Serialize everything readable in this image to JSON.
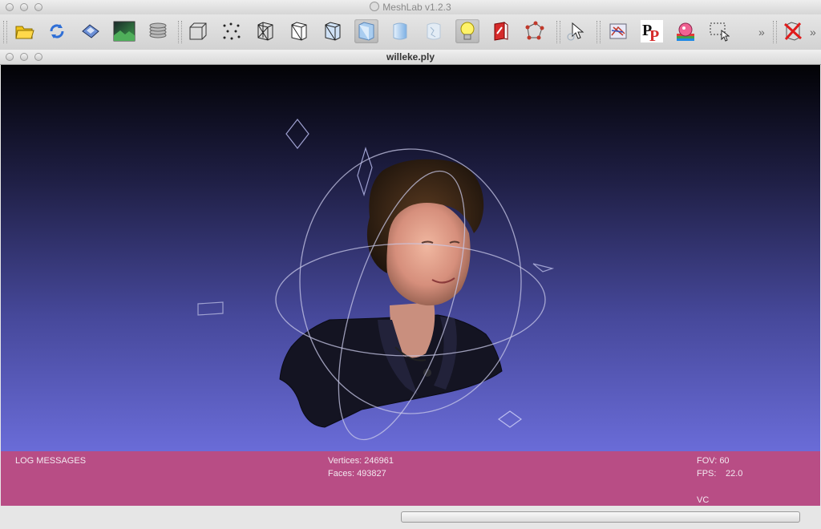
{
  "app": {
    "title": "MeshLab v1.2.3"
  },
  "toolbar": {
    "tools": [
      {
        "name": "open-icon"
      },
      {
        "name": "reload-icon"
      },
      {
        "name": "save-icon"
      },
      {
        "name": "snapshot-icon"
      },
      {
        "name": "layers-icon"
      },
      {
        "name": "bbox-icon"
      },
      {
        "name": "points-icon"
      },
      {
        "name": "wireframe-icon"
      },
      {
        "name": "hiddenlines-icon"
      },
      {
        "name": "flatlines-icon"
      },
      {
        "name": "flat-icon"
      },
      {
        "name": "smooth-icon"
      },
      {
        "name": "texture-icon"
      },
      {
        "name": "light-icon"
      },
      {
        "name": "backface-icon"
      },
      {
        "name": "select-vertices-icon"
      },
      {
        "name": "manipulator-icon"
      },
      {
        "name": "align-icon"
      },
      {
        "name": "paint-icon"
      },
      {
        "name": "color-icon"
      },
      {
        "name": "select-region-icon"
      },
      {
        "name": "close-mesh-icon"
      }
    ],
    "active": [
      "flat-icon",
      "light-icon"
    ]
  },
  "document": {
    "title": "willeke.ply"
  },
  "log": {
    "label": "LOG MESSAGES",
    "vertices": "Vertices: 246961",
    "faces": "Faces: 493827",
    "fov": "FOV: 60",
    "fps_label": "FPS:",
    "fps_value": "22.0",
    "mode": "VC"
  },
  "status": {
    "progress": 0
  }
}
